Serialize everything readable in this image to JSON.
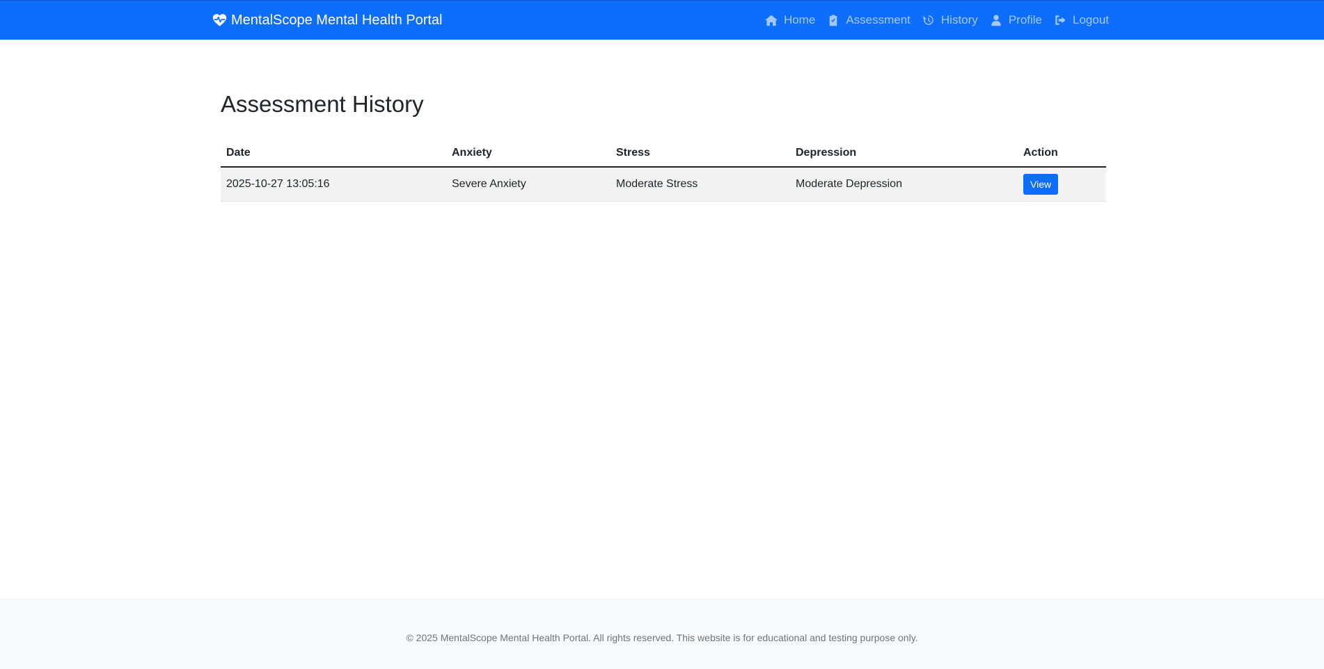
{
  "navbar": {
    "brand": "MentalScope Mental Health Portal",
    "links": [
      {
        "label": "Home",
        "icon": "home-icon"
      },
      {
        "label": "Assessment",
        "icon": "clipboard-icon"
      },
      {
        "label": "History",
        "icon": "history-icon"
      },
      {
        "label": "Profile",
        "icon": "user-icon"
      },
      {
        "label": "Logout",
        "icon": "logout-icon"
      }
    ],
    "color": "#0d6efd"
  },
  "page": {
    "title": "Assessment History"
  },
  "table": {
    "headers": [
      "Date",
      "Anxiety",
      "Stress",
      "Depression",
      "Action"
    ],
    "rows": [
      {
        "date": "2025-10-27 13:05:16",
        "anxiety": "Severe Anxiety",
        "stress": "Moderate Stress",
        "depression": "Moderate Depression",
        "action": "View"
      }
    ]
  },
  "footer": {
    "text": "© 2025 MentalScope Mental Health Portal. All rights reserved. This website is for educational and testing purpose only."
  }
}
